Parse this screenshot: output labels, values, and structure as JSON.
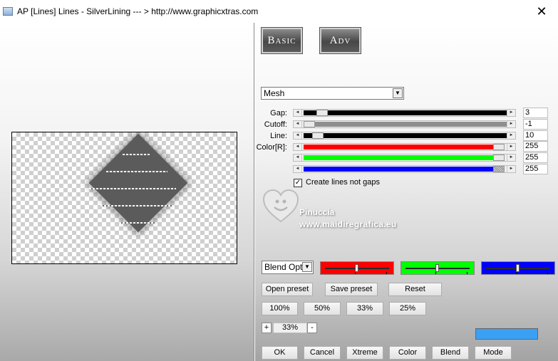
{
  "window": {
    "title": "AP [Lines]  Lines - SilverLining    --- > http://www.graphicxtras.com",
    "close_glyph": "✕"
  },
  "modes": {
    "basic": "Basic",
    "adv": "Adv"
  },
  "mode_select": {
    "value": "Mesh",
    "arrow": "▼"
  },
  "params": [
    {
      "label": "Gap:",
      "value": "3",
      "fraction": 0.04
    },
    {
      "label": "Cutoff:",
      "value": "-1",
      "fraction": 0.0
    },
    {
      "label": "Line:",
      "value": "10",
      "fraction": 0.035
    }
  ],
  "color": {
    "label": "Color[R]:",
    "red": "255",
    "green": "255",
    "blue": "255",
    "red_hex": "#ff0000",
    "green_hex": "#00ff00",
    "blue_hex": "#0000ff"
  },
  "checkbox": {
    "label": "Create lines not gaps",
    "checked": true,
    "mark": "✓"
  },
  "watermark": {
    "name": "Pinuccia",
    "url": "www.maidiregrafica.eu"
  },
  "blend": {
    "value": "Blend Opti",
    "arrow": "▼"
  },
  "channel_sliders": [
    {
      "color": "#ff0000",
      "level": 0.5
    },
    {
      "color": "#00ff00",
      "level": 0.5
    },
    {
      "color": "#0000ff",
      "level": 0.5
    }
  ],
  "presets": {
    "open": "Open preset",
    "save": "Save preset",
    "reset": "Reset"
  },
  "zoom_buttons": [
    "100%",
    "50%",
    "33%",
    "25%"
  ],
  "zoom": {
    "minus": "-",
    "plus": "+",
    "value": "33%"
  },
  "accent_color": "#3aa0f4",
  "footer_buttons": [
    "OK",
    "Cancel",
    "Xtreme",
    "Color",
    "Blend",
    "Mode"
  ]
}
